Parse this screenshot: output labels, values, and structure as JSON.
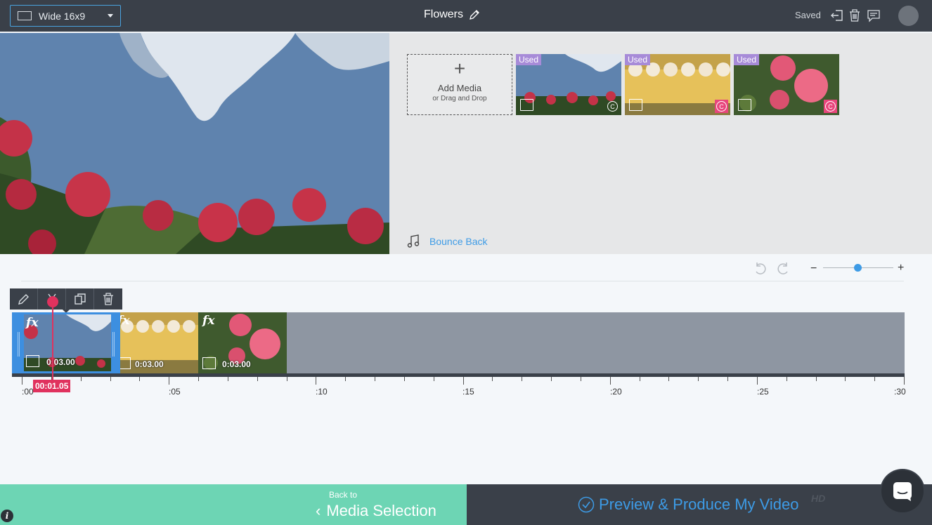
{
  "header": {
    "aspect_label": "Wide 16x9",
    "project_title": "Flowers",
    "saved_label": "Saved"
  },
  "media": {
    "add_title": "Add Media",
    "add_subtitle": "or Drag and Drop",
    "items": [
      {
        "badge": "Used",
        "subject": "red roses under blue sky"
      },
      {
        "badge": "Used",
        "subject": "white roses on yellow"
      },
      {
        "badge": "Used",
        "subject": "pink roses"
      }
    ],
    "music_track": "Bounce Back"
  },
  "timeline": {
    "clips": [
      {
        "fx": "fx",
        "duration": "0:03.00"
      },
      {
        "fx": "fx",
        "duration": "0:03.00"
      },
      {
        "fx": "fx",
        "duration": "0:03.00"
      }
    ],
    "playhead_time": "00:01.05",
    "tick_labels": [
      ":00",
      ":05",
      ":10",
      ":15",
      ":20",
      ":25",
      ":30"
    ],
    "zoom_level": 0.5
  },
  "footer": {
    "back_small": "Back to",
    "back_big": "Media Selection",
    "produce_label": "Preview & Produce My Video",
    "hd_label": "HD",
    "info_glyph": "i"
  },
  "colors": {
    "topbar": "#3a4049",
    "accent_blue": "#3d9be6",
    "mint": "#6dd5b4",
    "playhead": "#e0325e",
    "used_badge": "#a78bd8"
  }
}
